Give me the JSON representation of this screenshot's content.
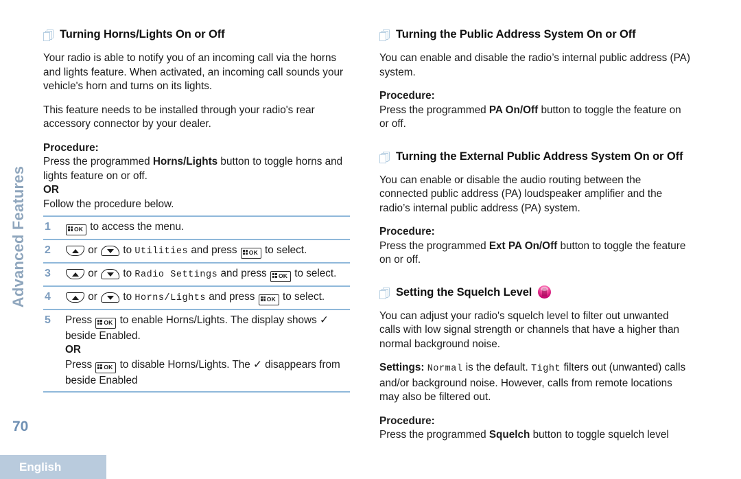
{
  "sidebar": {
    "chapter": "Advanced Features",
    "page_number": "70",
    "language": "English"
  },
  "icons": {
    "pages": "pages-stack-icon",
    "badge": "pink-radio-badge-icon",
    "key_ok": "menu-ok-button-icon",
    "key_up": "up-arrow-button-icon",
    "key_down": "down-arrow-button-icon"
  },
  "left_column": {
    "section1": {
      "heading": "Turning Horns/Lights On or Off",
      "para1": "Your radio is able to notify you of an incoming call via the horns and lights feature. When activated, an incoming call sounds your vehicle's horn and turns on its lights.",
      "para2": "This feature needs to be installed through your radio's rear accessory connector by your dealer.",
      "procedure_label": "Procedure:",
      "procedure_text_pre": "Press the programmed ",
      "procedure_bold": "Horns/Lights",
      "procedure_text_post": " button to toggle horns and lights feature on or off.",
      "or_label": "OR",
      "follow_text": "Follow the procedure below.",
      "steps": [
        {
          "num": "1",
          "parts": [
            {
              "type": "key-ok"
            },
            {
              "type": "text",
              "value": " to access the menu."
            }
          ]
        },
        {
          "num": "2",
          "parts": [
            {
              "type": "key-up"
            },
            {
              "type": "text",
              "value": " or "
            },
            {
              "type": "key-down"
            },
            {
              "type": "text",
              "value": " to "
            },
            {
              "type": "mono",
              "value": "Utilities"
            },
            {
              "type": "text",
              "value": " and press "
            },
            {
              "type": "key-ok"
            },
            {
              "type": "text",
              "value": " to select."
            }
          ]
        },
        {
          "num": "3",
          "parts": [
            {
              "type": "key-up"
            },
            {
              "type": "text",
              "value": " or "
            },
            {
              "type": "key-down"
            },
            {
              "type": "text",
              "value": " to "
            },
            {
              "type": "mono",
              "value": "Radio Settings"
            },
            {
              "type": "text",
              "value": " and press "
            },
            {
              "type": "key-ok"
            },
            {
              "type": "text",
              "value": " to select."
            }
          ]
        },
        {
          "num": "4",
          "parts": [
            {
              "type": "key-up"
            },
            {
              "type": "text",
              "value": " or "
            },
            {
              "type": "key-down"
            },
            {
              "type": "text",
              "value": " to "
            },
            {
              "type": "mono",
              "value": "Horns/Lights"
            },
            {
              "type": "text",
              "value": " and press "
            },
            {
              "type": "key-ok"
            },
            {
              "type": "text",
              "value": " to select."
            }
          ]
        },
        {
          "num": "5",
          "parts": [
            {
              "type": "text",
              "value": "Press "
            },
            {
              "type": "key-ok"
            },
            {
              "type": "text",
              "value": " to enable Horns/Lights. The display shows ✓ beside Enabled."
            },
            {
              "type": "break-bold",
              "value": "OR"
            },
            {
              "type": "text",
              "value": "Press "
            },
            {
              "type": "key-ok"
            },
            {
              "type": "text",
              "value": " to disable Horns/Lights. The ✓ disappears from beside Enabled"
            }
          ]
        }
      ]
    }
  },
  "right_column": {
    "section2": {
      "heading": "Turning the Public Address System On or Off",
      "para1": "You can enable and disable the radio’s internal public address (PA) system.",
      "procedure_label": "Procedure:",
      "procedure_text_pre": "Press the programmed ",
      "procedure_bold": "PA On/Off",
      "procedure_text_post": " button to toggle the feature on or off."
    },
    "section3": {
      "heading": "Turning the External Public Address System On or Off",
      "para1": "You can enable or disable the audio routing between the connected public address (PA) loudspeaker amplifier and the radio’s internal public address (PA) system.",
      "procedure_label": "Procedure:",
      "procedure_text_pre": "Press the programmed ",
      "procedure_bold": "Ext PA On/Off",
      "procedure_text_post": " button to toggle the feature on or off."
    },
    "section4": {
      "heading": "Setting the Squelch Level",
      "para1": "You can adjust your radio's squelch level to filter out unwanted calls with low signal strength or channels that have a higher than normal background noise.",
      "settings_label": "Settings:",
      "settings_mono1": "Normal",
      "settings_mid": " is the default. ",
      "settings_mono2": "Tight",
      "settings_post": " filters out (unwanted) calls and/or background noise. However, calls from remote locations may also be filtered out.",
      "procedure_label": "Procedure:",
      "procedure_text_pre": "Press the programmed ",
      "procedure_bold": "Squelch",
      "procedure_text_post": " button to toggle squelch level"
    }
  },
  "colors": {
    "accent_blue": "#8fb8da",
    "rail_text": "#8fa6bd",
    "step_number": "#7d9dbf",
    "language_bar": "#b9cbdd",
    "badge_pink": "#ef4398"
  }
}
